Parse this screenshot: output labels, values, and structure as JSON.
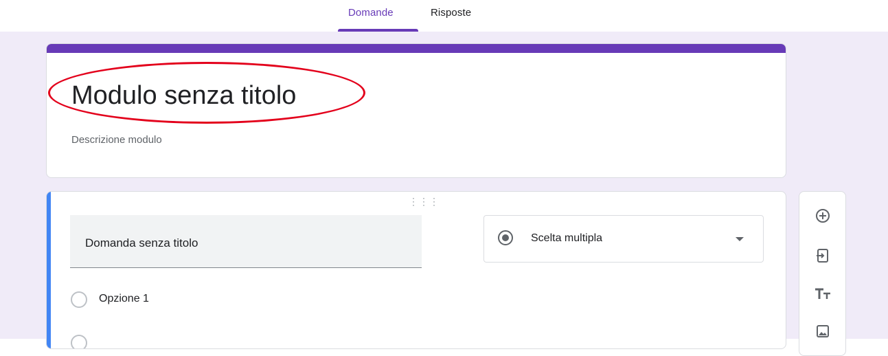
{
  "tabs": [
    {
      "label": "Domande",
      "active": true
    },
    {
      "label": "Risposte",
      "active": false
    }
  ],
  "form": {
    "title": "Modulo senza titolo",
    "description": "Descrizione modulo"
  },
  "question": {
    "title": "Domanda senza titolo",
    "type_label": "Scelta multipla",
    "options": [
      "Opzione 1"
    ]
  },
  "toolbar": [
    "add-question-icon",
    "import-questions-icon",
    "add-title-icon",
    "add-image-icon"
  ],
  "colors": {
    "accent": "#673ab7",
    "question_accent": "#4285f4",
    "background": "#f0ebf8",
    "annotation": "#e3001b"
  }
}
